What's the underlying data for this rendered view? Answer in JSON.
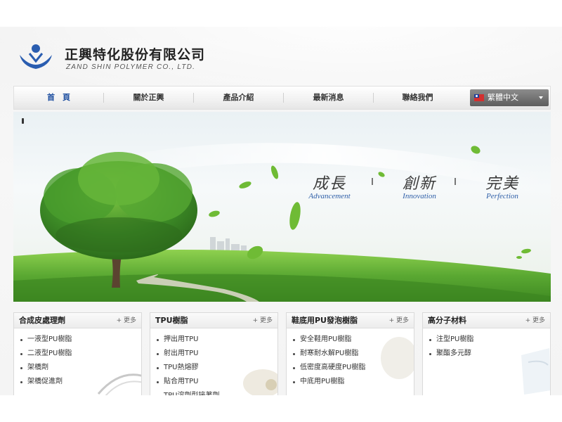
{
  "header": {
    "company_name": "正興特化股份有限公司",
    "company_en": "ZAND SHIN POLYMER CO., LTD."
  },
  "nav": {
    "items": [
      {
        "label": "首　頁",
        "active": true
      },
      {
        "label": "關於正興",
        "active": false
      },
      {
        "label": "產品介紹",
        "active": false
      },
      {
        "label": "最新消息",
        "active": false
      },
      {
        "label": "聯絡我們",
        "active": false
      }
    ],
    "language": "繁體中文"
  },
  "banner": {
    "slogans": [
      {
        "zh": "成長",
        "en": "Advancement"
      },
      {
        "zh": "創新",
        "en": "Innovation"
      },
      {
        "zh": "完美",
        "en": "Perfection"
      }
    ]
  },
  "panels": [
    {
      "title": "合成皮處理劑",
      "more": "+ 更多",
      "items": [
        "一液型PU樹脂",
        "二液型PU樹脂",
        "架橋劑",
        "架橋促進劑"
      ]
    },
    {
      "title": "TPU樹脂",
      "more": "+ 更多",
      "items": [
        "押出用TPU",
        "射出用TPU",
        "TPU熱熔膠",
        "貼合用TPU",
        "TPU溶劑型接著劑"
      ]
    },
    {
      "title": "鞋底用PU發泡樹脂",
      "more": "+ 更多",
      "items": [
        "安全鞋用PU樹脂",
        "耐寒耐水解PU樹脂",
        "低密度高硬度PU樹脂",
        "中底用PU樹脂"
      ]
    },
    {
      "title": "高分子材料",
      "more": "+ 更多",
      "items": [
        "注型PU樹脂",
        "聚酯多元醇"
      ]
    }
  ],
  "colors": {
    "accent": "#1e4fa0",
    "slogan_en": "#2f5fa8",
    "grass": "#5aa832",
    "logo_blue": "#2a5db0"
  }
}
